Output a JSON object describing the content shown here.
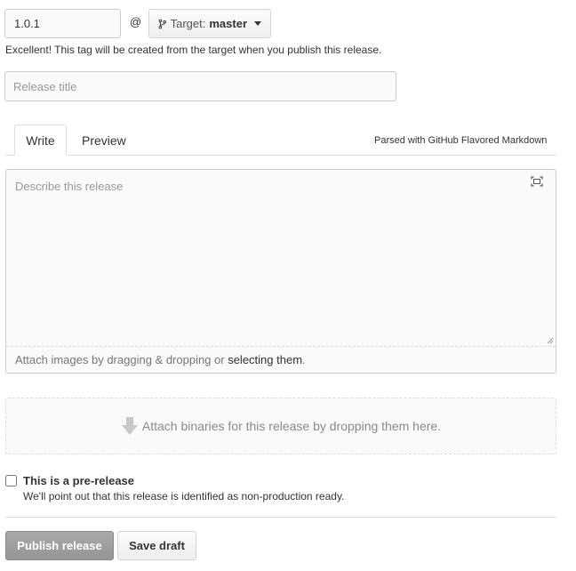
{
  "tag": {
    "value": "1.0.1",
    "separator": "@",
    "target_label": "Target:",
    "target_value": "master",
    "hint": "Excellent! This tag will be created from the target when you publish this release."
  },
  "release_title": {
    "placeholder": "Release title",
    "value": ""
  },
  "tabs": {
    "write": "Write",
    "preview": "Preview",
    "markdown_note": "Parsed with GitHub Flavored Markdown"
  },
  "description": {
    "placeholder": "Describe this release",
    "attach_prefix": "Attach images by dragging & dropping or ",
    "attach_link": "selecting them",
    "attach_suffix": "."
  },
  "binaries": {
    "text": "Attach binaries for this release by dropping them here."
  },
  "prerelease": {
    "checked": false,
    "title": "This is a pre-release",
    "description": "We'll point out that this release is identified as non-production ready."
  },
  "actions": {
    "publish": "Publish release",
    "save_draft": "Save draft"
  },
  "icons": {
    "branch": "branch-icon",
    "caret": "caret-down-icon",
    "fullscreen": "fullscreen-icon",
    "upload": "down-arrow-icon"
  }
}
